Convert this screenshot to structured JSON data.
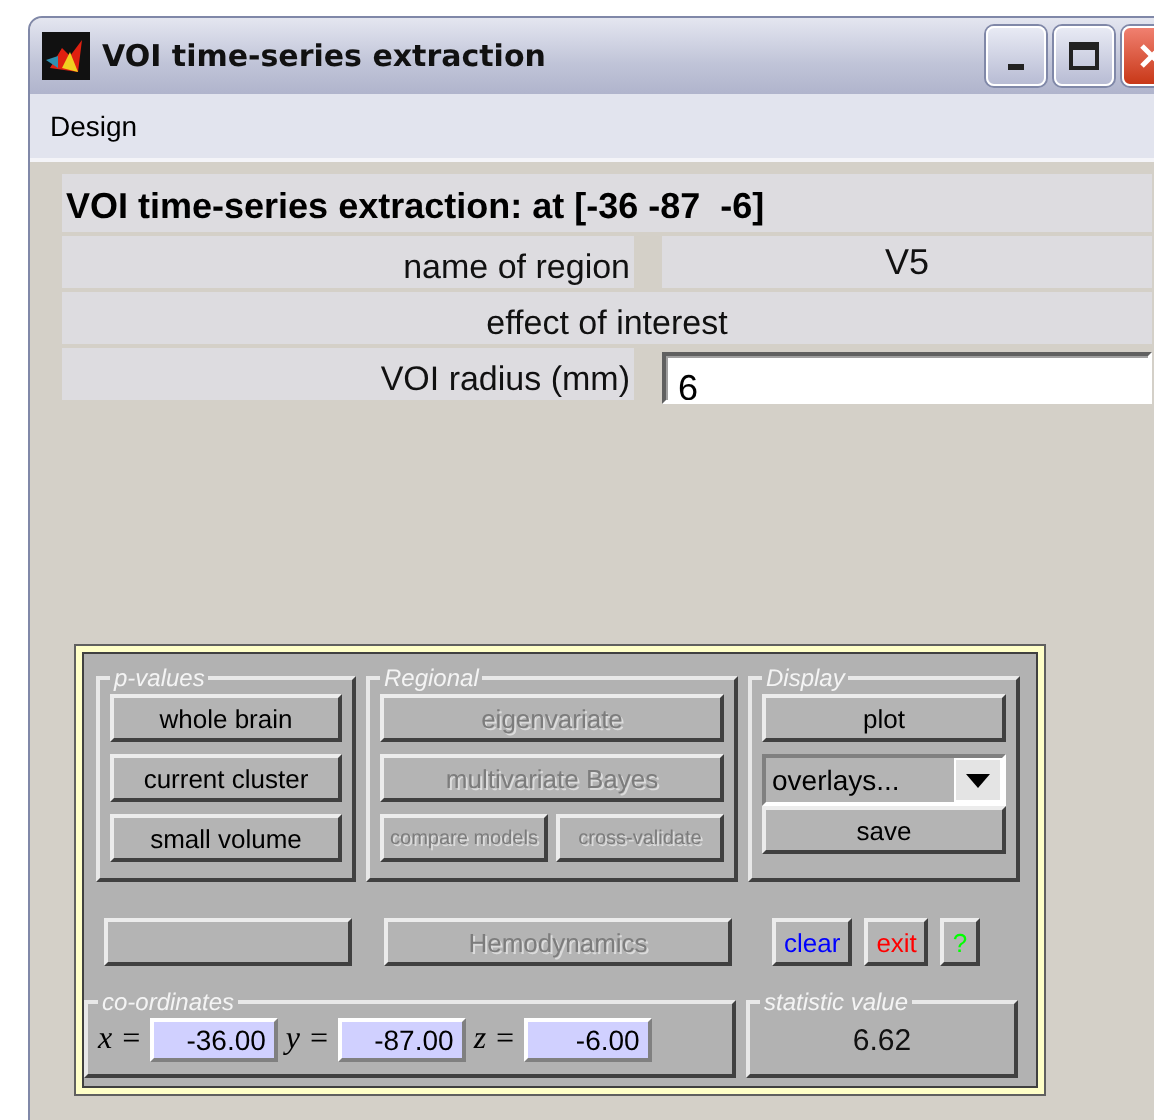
{
  "window": {
    "title": "VOI time-series extraction"
  },
  "menu": [
    {
      "label": "Design"
    }
  ],
  "heading": "VOI time-series extraction: at [-36 -87  -6]",
  "fields": [
    {
      "kind": "pair",
      "label": "name of region",
      "value": "V5"
    },
    {
      "kind": "text",
      "label": "effect of interest"
    },
    {
      "kind": "input",
      "label": "VOI radius (mm)",
      "value": "6"
    }
  ],
  "panel": {
    "p_values": {
      "legend": "p-values",
      "buttons": [
        {
          "label": "whole brain",
          "disabled": false
        },
        {
          "label": "current cluster",
          "disabled": false
        },
        {
          "label": "small volume",
          "disabled": false
        }
      ]
    },
    "regional": {
      "legend": "Regional",
      "buttons": [
        {
          "label": "eigenvariate",
          "disabled": true,
          "kind": "wide"
        },
        {
          "label": "multivariate Bayes",
          "disabled": true,
          "kind": "wide"
        },
        {
          "label": "compare models",
          "disabled": true,
          "kind": "small"
        },
        {
          "label": "cross-validate",
          "disabled": true,
          "kind": "small"
        }
      ]
    },
    "display": {
      "legend": "Display",
      "plot": "plot",
      "dropdown": "overlays...",
      "save": "save"
    },
    "actions": [
      {
        "kind": "blank"
      },
      {
        "kind": "wide",
        "label": "Hemodynamics",
        "disabled": true
      },
      {
        "kind": "small",
        "label": "clear",
        "color": "#0000ff",
        "disabled": false
      },
      {
        "kind": "small",
        "label": "exit",
        "color": "#ff0000",
        "disabled": false
      },
      {
        "kind": "small",
        "label": "?",
        "color": "#00ff00",
        "disabled": false
      }
    ],
    "coordinates": {
      "legend": "co-ordinates",
      "fields": [
        {
          "label": "x =",
          "value": "-36.00"
        },
        {
          "label": "y =",
          "value": "-87.00"
        },
        {
          "label": "z =",
          "value": "-6.00"
        }
      ]
    },
    "statistic": {
      "legend": "statistic value",
      "value": "6.62"
    }
  }
}
